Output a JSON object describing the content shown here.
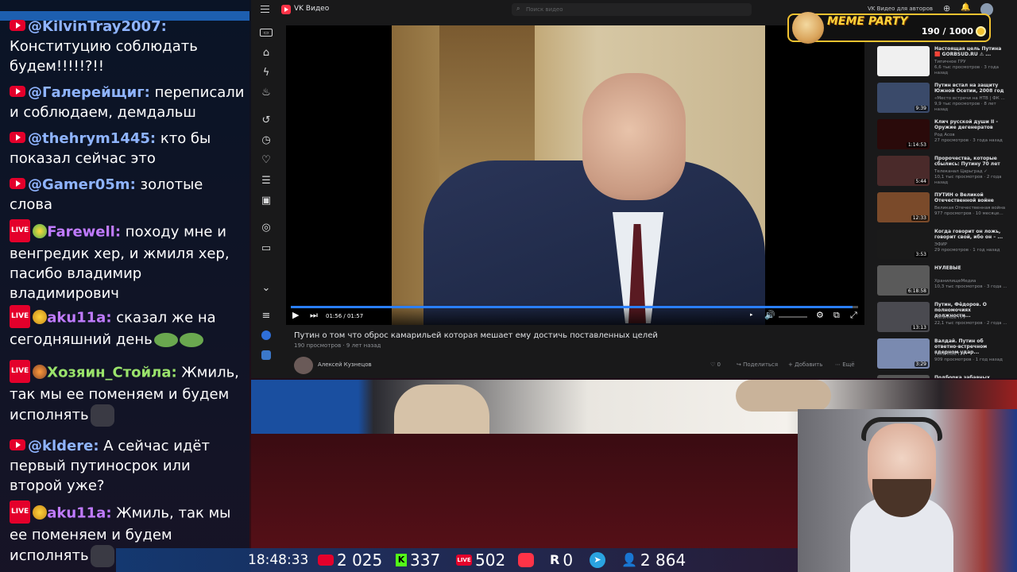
{
  "chat": {
    "messages": [
      {
        "badge": "youtube",
        "nick": "@KilvinTray2007:",
        "nick_color": "#8fb4ff",
        "text": "Конституцию соблюдать будем!!!!!?!!"
      },
      {
        "badge": "youtube",
        "nick": "@Галерейщиг:",
        "nick_color": "#8fb4ff",
        "text": "переписали и соблюдаем, демдальш"
      },
      {
        "badge": "youtube",
        "nick": "@thehrym1445:",
        "nick_color": "#8fb4ff",
        "text": "кто бы показал сейчас это"
      },
      {
        "badge": "youtube",
        "nick": "@Gamer05m:",
        "nick_color": "#8fb4ff",
        "text": "золотые слова"
      },
      {
        "badge": "live",
        "nick": "Farewell:",
        "nick_color": "#c07bff",
        "text": "походу мне и венгредик хер, и жмиля хер, пасибо владимир владимирович"
      },
      {
        "badge": "live",
        "nick": "aku11a:",
        "nick_color": "#c07bff",
        "text": "сказал же на сегодняшний день"
      },
      {
        "badge": "live",
        "nick": "Хозяин_Стойла:",
        "nick_color": "#9ae36b",
        "text": "Жмиль, так мы ее поменяем и будем исполнять"
      },
      {
        "badge": "youtube",
        "nick": "@kldere:",
        "nick_color": "#8fb4ff",
        "text": "А сейчас идёт первый путиносрок или второй уже?"
      },
      {
        "badge": "live",
        "nick": "aku11a:",
        "nick_color": "#c07bff",
        "text": "Жмиль, так мы ее поменяем и будем исполнять"
      }
    ],
    "live_label": "LIVE"
  },
  "vk": {
    "logo_text": "VK Видео",
    "search_placeholder": "Поиск видео",
    "for_authors_label": "VK Видео для авторов",
    "player": {
      "current_time": "01:56",
      "duration": "01:57",
      "time_text": "01:56 / 01:57",
      "progress_fraction": 0.99
    },
    "video": {
      "title": "Путин о том что обрoс камарильей которая мешает ему достичь поставленных целей",
      "views": "190 просмотров",
      "age": "9 лет назад",
      "author": "Алексей Кузнецов",
      "likes": "0",
      "share_label": "Поделиться",
      "add_label": "Добавить",
      "more_label": "Ещё"
    },
    "recommendations": [
      {
        "title": "Настоящая цель Путина 🟥 GORBSUD.RU ⚠ ...",
        "channel": "Типичное ГРУ",
        "meta": "6,6 тыс просмотров · 3 года назад",
        "duration": "",
        "thumb_color": "#f0f0f0"
      },
      {
        "title": "Путин встал на защиту Южной Осетии, 2008 год",
        "channel": "«Место встречи на НТВ | ФК ...",
        "meta": "9,9 тыс просмотров · 8 лет назад",
        "duration": "9:39",
        "thumb_color": "#3a4a6a"
      },
      {
        "title": "Клич русской души II - Оружие дегенератов",
        "channel": "Род Асов",
        "meta": "27 просмотров · 3 года назад",
        "duration": "1:14:53",
        "thumb_color": "#2a0a0a"
      },
      {
        "title": "Пророчества, которые сбылись: Путину 70 лет",
        "channel": "Телеканал Царьград ✓",
        "meta": "10,1 тыс просмотров · 2 года назад",
        "duration": "5:44",
        "thumb_color": "#4a2a2a"
      },
      {
        "title": "ПУТИН о Великой Отечественной войне",
        "channel": "Великая Отечественная война",
        "meta": "977 просмотров · 10 месяце...",
        "duration": "12:33",
        "thumb_color": "#7a4a2a"
      },
      {
        "title": "Когда говорит он ложь, говорит свой, ибо он – ...",
        "channel": "ЭФИР",
        "meta": "29 просмотров · 1 год назад",
        "duration": "3:53",
        "thumb_color": "#1a1a1a"
      },
      {
        "title": "НУЛЕВЫЕ",
        "channel": "ХранилищеМедиа",
        "meta": "10,3 тыс просмотров · 3 года ...",
        "duration": "6:18:58",
        "thumb_color": "#5a5a5a"
      },
      {
        "title": "Путин, Фёдоров. О полномочиях должности...",
        "channel": "Типичное ГРУ",
        "meta": "22,1 тыс просмотров · 2 года ...",
        "duration": "13:13",
        "thumb_color": "#4a4a50"
      },
      {
        "title": "Валдай. Путин об ответно-встречном ядерном удар...",
        "channel": "Типичное ГРУ",
        "meta": "909 просмотров · 1 год назад",
        "duration": "3:29",
        "thumb_color": "#7a8ab0"
      },
      {
        "title": "Подборка забавных",
        "channel": "",
        "meta": "",
        "duration": "",
        "thumb_color": "#555"
      }
    ]
  },
  "meme_party": {
    "title": "MEME PARTY",
    "progress_text": "190 / 1000",
    "progress_value": 190,
    "progress_max": 1000
  },
  "stats": {
    "time": "18:48:33",
    "youtube_viewers": "2 025",
    "kick_viewers": "337",
    "vk_live_viewers": "502",
    "rutube_viewers": "0",
    "telegram_label": "",
    "total_viewers": "2 864"
  },
  "colors": {
    "vk_bg": "#19191a",
    "accent_blue": "#2a7fff",
    "youtube_red": "#e4002b",
    "meme_gold": "#f2c230"
  }
}
